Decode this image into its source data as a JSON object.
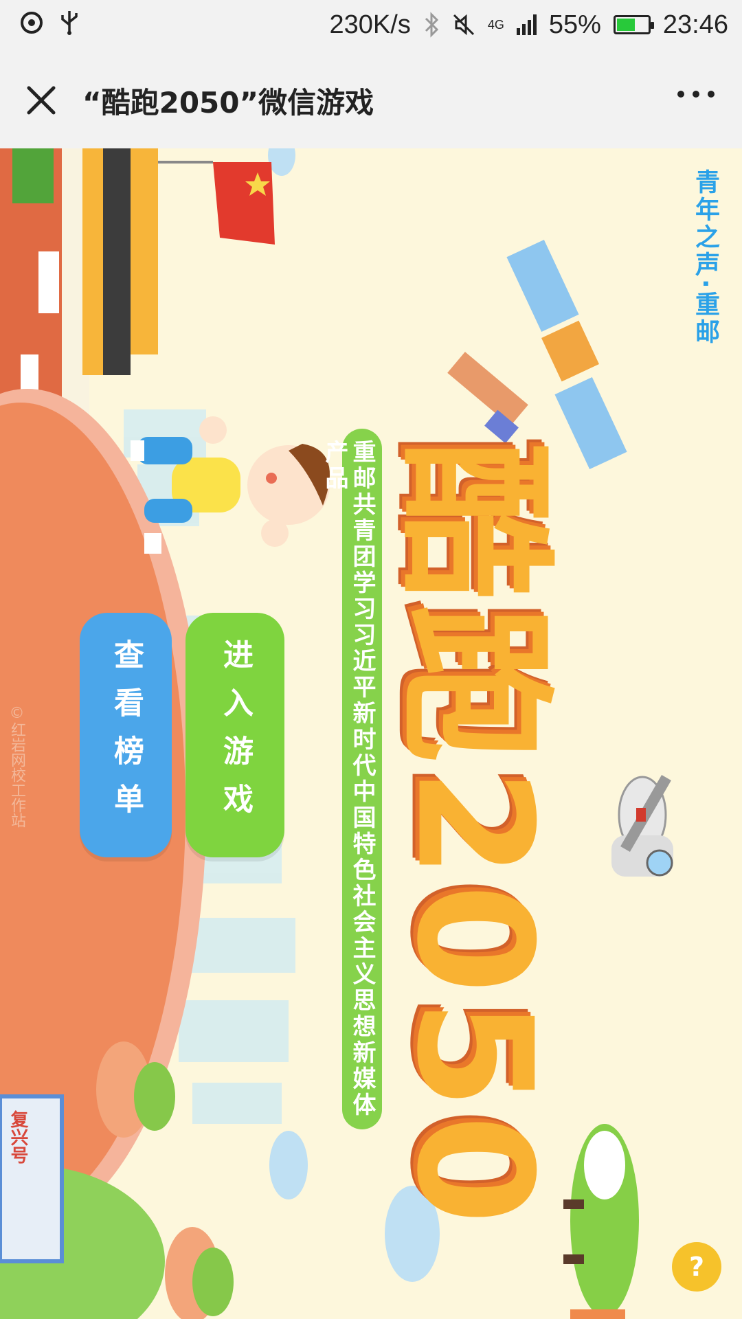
{
  "status_bar": {
    "network_speed": "230K/s",
    "network_type": "4G",
    "battery_percent": "55%",
    "battery_level": 0.55,
    "time": "23:46",
    "icons": [
      "hotspot-icon",
      "usb-icon",
      "bluetooth-icon",
      "mute-icon",
      "signal-icon",
      "battery-icon"
    ]
  },
  "title_bar": {
    "title": "“酷跑2050”微信游戏",
    "close_icon": "close-icon",
    "more_icon": "more-icon"
  },
  "game": {
    "brand": "青年之声·重邮",
    "title": "酷跑2050",
    "subtitle": "重邮共青团学习习近平新时代中国特色社会主义思想新媒体产品",
    "enter_button": "进入游戏",
    "rank_button": "查看榜单",
    "copyright": "©红岩网校工作站",
    "train_label": "复兴号",
    "help_button": "?",
    "colors": {
      "background": "#fdf7dc",
      "title_orange": "#f9b233",
      "enter_green": "#7fd43f",
      "rank_blue": "#4ba6ea",
      "planet": "#ef8a5c"
    }
  }
}
